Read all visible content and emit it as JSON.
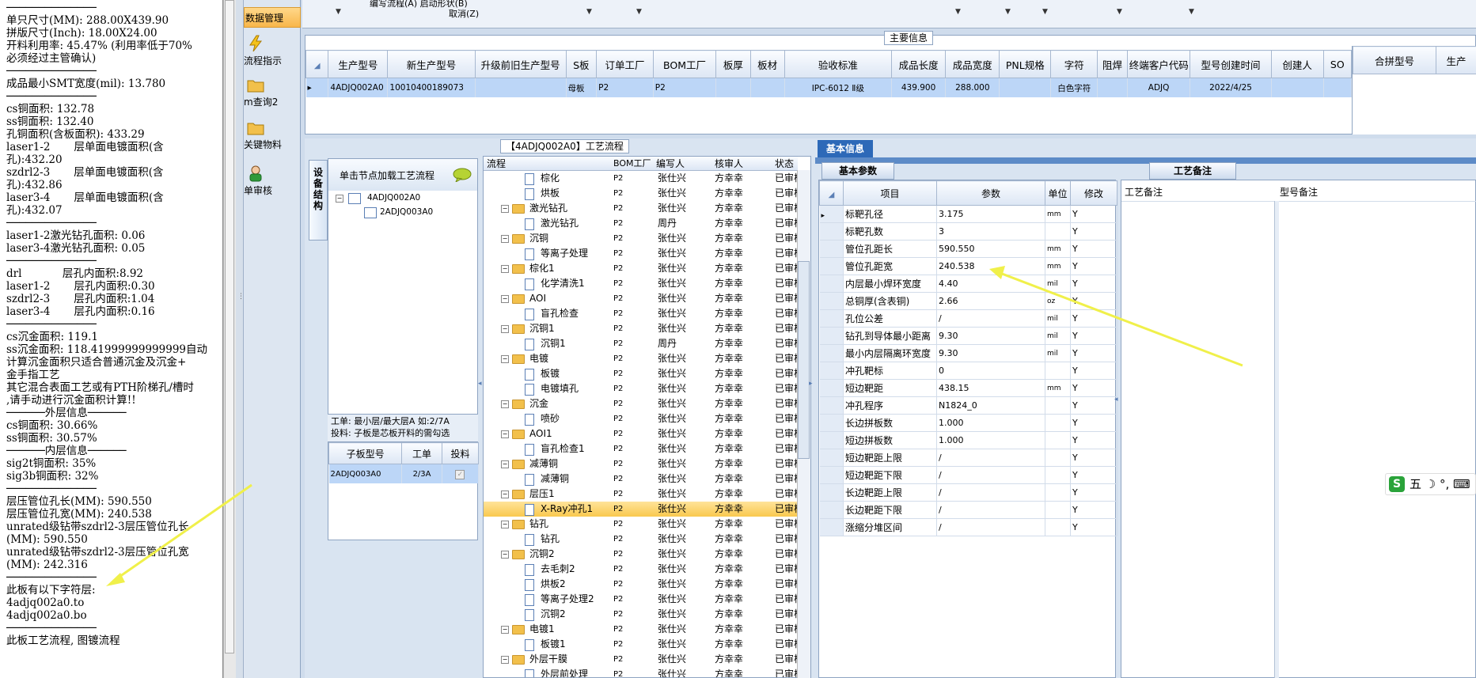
{
  "notepad": {
    "text": "──────────────\n单只尺寸(MM): 288.00X439.90\n拼版尺寸(Inch): 18.00X24.00\n开料利用率: 45.47% (利用率低于70%\n必须经过主管确认)\n──────────────\n成品最小SMT宽度(mil): 13.780\n──────────────\ncs铜面积: 132.78\nss铜面积: 132.40\n孔铜面积(含板面积): 433.29\nlaser1-2       层单面电镀面积(含\n孔):432.20\nszdrl2-3       层单面电镀面积(含\n孔):432.86\nlaser3-4       层单面电镀面积(含\n孔):432.07\n──────────────\nlaser1-2激光钻孔面积: 0.06\nlaser3-4激光钻孔面积: 0.05\n──────────────\ndrl            层孔内面积:8.92\nlaser1-2       层孔内面积:0.30\nszdrl2-3       层孔内面积:1.04\nlaser3-4       层孔内面积:0.16\n──────────────\ncs沉金面积: 119.1\nss沉金面积: 118.41999999999999自动\n计算沉金面积只适合普通沉金及沉金+\n金手指工艺\n其它混合表面工艺或有PTH阶梯孔/槽时\n,请手动进行沉金面积计算!!\n──────外层信息──────\ncs铜面积: 30.66%\nss铜面积: 30.57%\n──────内层信息──────\nsig2t铜面积: 35%\nsig3b铜面积: 32%\n──────────────\n层压管位孔长(MM): 590.550\n层压管位孔宽(MM): 240.538\nunrated级钻带szdrl2-3层压管位孔长\n(MM): 590.550\nunrated级钻带szdrl2-3层压管位孔宽\n(MM): 242.316\n──────────────\n此板有以下字符层:\n4adjq002a0.to\n4adjq002a0.bo\n──────────────\n此板工艺流程, 图镀流程"
  },
  "nav": {
    "items": [
      {
        "label": "数据管理",
        "active": true
      },
      {
        "label": "流程指示"
      },
      {
        "label": "m查询2"
      },
      {
        "label": "关键物料"
      },
      {
        "label": "单审核"
      }
    ]
  },
  "filterbar": {
    "texts": [
      "编写流程(A)    启动形状(B)",
      "取消(Z)"
    ]
  },
  "main_info": {
    "title": "主要信息",
    "columns": [
      "生产型号",
      "新生产型号",
      "升级前旧生产型号",
      "S板",
      "订单工厂",
      "BOM工厂",
      "板厚",
      "板材",
      "验收标准",
      "成品长度",
      "成品宽度",
      "PNL规格",
      "字符",
      "阻焊",
      "终端客户代码",
      "型号创建时间",
      "创建人",
      "SO"
    ],
    "row": [
      "4ADJQ002A0",
      "10010400189073",
      "",
      "母板",
      "P2",
      "P2",
      "",
      "",
      "IPC-6012 Ⅱ级",
      "439.900",
      "288.000",
      "",
      "白色字符",
      "",
      "ADJQ",
      "2022/4/25",
      "",
      ""
    ]
  },
  "merge_table": {
    "columns": [
      "合拼型号",
      "生产"
    ]
  },
  "left_panel": {
    "vtab_label": "设备结构",
    "header": "单击节点加载工艺流程",
    "tree": [
      "4ADJQ002A0",
      "2ADJQ003A0"
    ],
    "work_note_1": "工单: 最小层/最大层A 如:2/7A",
    "work_note_2": "投料: 子板是芯板开料的需勾选",
    "sub_columns": [
      "子板型号",
      "工单",
      "投料"
    ],
    "sub_row": [
      "2ADJQ003A0",
      "2/3A",
      ""
    ]
  },
  "flow": {
    "title": "【4ADJQ002A0】工艺流程",
    "columns": [
      "流程",
      "BOM工厂",
      "编写人",
      "核审人",
      "状态"
    ],
    "rows": [
      {
        "name": "棕化",
        "level": 2,
        "bom": "P2",
        "writer": "张仕兴",
        "reviewer": "方幸幸",
        "status": "已审核"
      },
      {
        "name": "烘板",
        "level": 2,
        "bom": "P2",
        "writer": "张仕兴",
        "reviewer": "方幸幸",
        "status": "已审核"
      },
      {
        "name": "激光钻孔",
        "level": 1,
        "bom": "P2",
        "writer": "张仕兴",
        "reviewer": "方幸幸",
        "status": "已审核"
      },
      {
        "name": "激光钻孔",
        "level": 2,
        "bom": "P2",
        "writer": "周丹",
        "reviewer": "方幸幸",
        "status": "已审核"
      },
      {
        "name": "沉铜",
        "level": 1,
        "bom": "P2",
        "writer": "张仕兴",
        "reviewer": "方幸幸",
        "status": "已审核"
      },
      {
        "name": "等离子处理",
        "level": 2,
        "bom": "P2",
        "writer": "张仕兴",
        "reviewer": "方幸幸",
        "status": "已审核"
      },
      {
        "name": "棕化1",
        "level": 1,
        "bom": "P2",
        "writer": "张仕兴",
        "reviewer": "方幸幸",
        "status": "已审核"
      },
      {
        "name": "化学清洗1",
        "level": 2,
        "bom": "P2",
        "writer": "张仕兴",
        "reviewer": "方幸幸",
        "status": "已审核"
      },
      {
        "name": "AOI",
        "level": 1,
        "bom": "P2",
        "writer": "张仕兴",
        "reviewer": "方幸幸",
        "status": "已审核"
      },
      {
        "name": "盲孔检查",
        "level": 2,
        "bom": "P2",
        "writer": "张仕兴",
        "reviewer": "方幸幸",
        "status": "已审核"
      },
      {
        "name": "沉铜1",
        "level": 1,
        "bom": "P2",
        "writer": "张仕兴",
        "reviewer": "方幸幸",
        "status": "已审核"
      },
      {
        "name": "沉铜1",
        "level": 2,
        "bom": "P2",
        "writer": "周丹",
        "reviewer": "方幸幸",
        "status": "已审核"
      },
      {
        "name": "电镀",
        "level": 1,
        "bom": "P2",
        "writer": "张仕兴",
        "reviewer": "方幸幸",
        "status": "已审核"
      },
      {
        "name": "板镀",
        "level": 2,
        "bom": "P2",
        "writer": "张仕兴",
        "reviewer": "方幸幸",
        "status": "已审核"
      },
      {
        "name": "电镀填孔",
        "level": 2,
        "bom": "P2",
        "writer": "张仕兴",
        "reviewer": "方幸幸",
        "status": "已审核"
      },
      {
        "name": "沉金",
        "level": 1,
        "bom": "P2",
        "writer": "张仕兴",
        "reviewer": "方幸幸",
        "status": "已审核"
      },
      {
        "name": "喷砂",
        "level": 2,
        "bom": "P2",
        "writer": "张仕兴",
        "reviewer": "方幸幸",
        "status": "已审核"
      },
      {
        "name": "AOI1",
        "level": 1,
        "bom": "P2",
        "writer": "张仕兴",
        "reviewer": "方幸幸",
        "status": "已审核"
      },
      {
        "name": "盲孔检查1",
        "level": 2,
        "bom": "P2",
        "writer": "张仕兴",
        "reviewer": "方幸幸",
        "status": "已审核"
      },
      {
        "name": "减薄铜",
        "level": 1,
        "bom": "P2",
        "writer": "张仕兴",
        "reviewer": "方幸幸",
        "status": "已审核"
      },
      {
        "name": "减薄铜",
        "level": 2,
        "bom": "P2",
        "writer": "张仕兴",
        "reviewer": "方幸幸",
        "status": "已审核"
      },
      {
        "name": "层压1",
        "level": 1,
        "bom": "P2",
        "writer": "张仕兴",
        "reviewer": "方幸幸",
        "status": "已审核"
      },
      {
        "name": "X-Ray冲孔1",
        "level": 2,
        "bom": "P2",
        "writer": "张仕兴",
        "reviewer": "方幸幸",
        "status": "已审核",
        "selected": true
      },
      {
        "name": "钻孔",
        "level": 1,
        "bom": "P2",
        "writer": "张仕兴",
        "reviewer": "方幸幸",
        "status": "已审核"
      },
      {
        "name": "钻孔",
        "level": 2,
        "bom": "P2",
        "writer": "张仕兴",
        "reviewer": "方幸幸",
        "status": "已审核"
      },
      {
        "name": "沉铜2",
        "level": 1,
        "bom": "P2",
        "writer": "张仕兴",
        "reviewer": "方幸幸",
        "status": "已审核"
      },
      {
        "name": "去毛刺2",
        "level": 2,
        "bom": "P2",
        "writer": "张仕兴",
        "reviewer": "方幸幸",
        "status": "已审核"
      },
      {
        "name": "烘板2",
        "level": 2,
        "bom": "P2",
        "writer": "张仕兴",
        "reviewer": "方幸幸",
        "status": "已审核"
      },
      {
        "name": "等离子处理2",
        "level": 2,
        "bom": "P2",
        "writer": "张仕兴",
        "reviewer": "方幸幸",
        "status": "已审核"
      },
      {
        "name": "沉铜2",
        "level": 2,
        "bom": "P2",
        "writer": "张仕兴",
        "reviewer": "方幸幸",
        "status": "已审核"
      },
      {
        "name": "电镀1",
        "level": 1,
        "bom": "P2",
        "writer": "张仕兴",
        "reviewer": "方幸幸",
        "status": "已审核"
      },
      {
        "name": "板镀1",
        "level": 2,
        "bom": "P2",
        "writer": "张仕兴",
        "reviewer": "方幸幸",
        "status": "已审核"
      },
      {
        "name": "外层干膜",
        "level": 1,
        "bom": "P2",
        "writer": "张仕兴",
        "reviewer": "方幸幸",
        "status": "已审核"
      },
      {
        "name": "外层前处理",
        "level": 2,
        "bom": "P2",
        "writer": "张仕兴",
        "reviewer": "方幸幸",
        "status": "已审核"
      }
    ]
  },
  "basic_info": {
    "tab": "基本信息",
    "params_tab": "基本参数",
    "columns": [
      "项目",
      "参数",
      "单位",
      "修改"
    ],
    "rows": [
      {
        "item": "标靶孔径",
        "value": "3.175",
        "unit": "mm",
        "mod": "Y"
      },
      {
        "item": "标靶孔数",
        "value": "3",
        "unit": "",
        "mod": "Y"
      },
      {
        "item": "管位孔距长",
        "value": "590.550",
        "unit": "mm",
        "mod": "Y"
      },
      {
        "item": "管位孔距宽",
        "value": "240.538",
        "unit": "mm",
        "mod": "Y"
      },
      {
        "item": "内层最小焊环宽度",
        "value": "4.40",
        "unit": "mil",
        "mod": "Y"
      },
      {
        "item": "总铜厚(含表铜)",
        "value": "2.66",
        "unit": "oz",
        "mod": "Y"
      },
      {
        "item": "孔位公差",
        "value": "/",
        "unit": "mil",
        "mod": "Y"
      },
      {
        "item": "钻孔到导体最小距离",
        "value": "9.30",
        "unit": "mil",
        "mod": "Y"
      },
      {
        "item": "最小内层隔离环宽度",
        "value": "9.30",
        "unit": "mil",
        "mod": "Y"
      },
      {
        "item": "冲孔靶标",
        "value": "0",
        "unit": "",
        "mod": "Y"
      },
      {
        "item": "短边靶距",
        "value": "438.15",
        "unit": "mm",
        "mod": "Y"
      },
      {
        "item": "冲孔程序",
        "value": "N1824_0",
        "unit": "",
        "mod": "Y"
      },
      {
        "item": "长边拼板数",
        "value": "1.000",
        "unit": "",
        "mod": "Y"
      },
      {
        "item": "短边拼板数",
        "value": "1.000",
        "unit": "",
        "mod": "Y"
      },
      {
        "item": "短边靶距上限",
        "value": "/",
        "unit": "",
        "mod": "Y"
      },
      {
        "item": "短边靶距下限",
        "value": "/",
        "unit": "",
        "mod": "Y"
      },
      {
        "item": "长边靶距上限",
        "value": "/",
        "unit": "",
        "mod": "Y"
      },
      {
        "item": "长边靶距下限",
        "value": "/",
        "unit": "",
        "mod": "Y"
      },
      {
        "item": "涨缩分堆区间",
        "value": "/",
        "unit": "",
        "mod": "Y"
      }
    ]
  },
  "notes": {
    "tab": "工艺备注",
    "col1": "工艺备注",
    "col2": "型号备注"
  },
  "ime": {
    "logo": "S",
    "text": "五 ☽ °, ⌨"
  },
  "colors": {
    "annotation_arrow": "#f0f04a",
    "selection_row": "#bcd6f7",
    "highlight_row": "#f9c94e",
    "accent": "#2d69b8"
  }
}
